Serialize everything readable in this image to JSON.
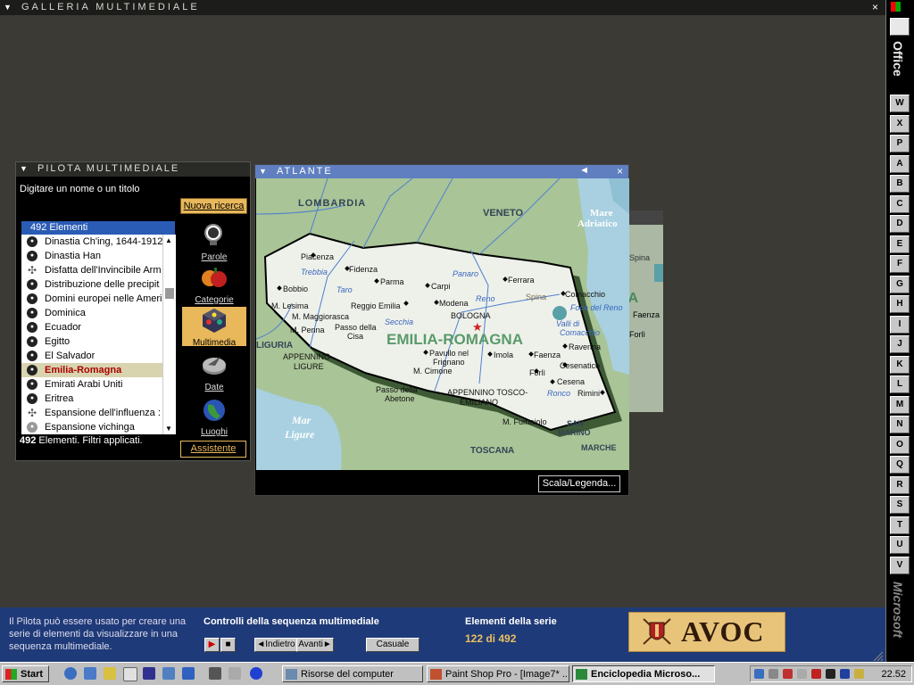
{
  "gallery": {
    "title": "GALLERIA MULTIMEDIALE",
    "menu_icon": "triangle-down-icon",
    "close": "×"
  },
  "office_bar": {
    "label_top": "Office",
    "label_bottom": "Microsoft",
    "buttons": [
      "W",
      "X",
      "P",
      "A",
      "B",
      "C",
      "D",
      "E",
      "F",
      "G",
      "H",
      "I",
      "J",
      "K",
      "L",
      "M",
      "N",
      "O",
      "Q",
      "R",
      "S",
      "T",
      "U",
      "V"
    ]
  },
  "pilota": {
    "title": "PILOTA MULTIMEDIALE",
    "prompt": "Digitare un nome o un titolo",
    "new_search": "Nuova ricerca",
    "list_header": "492 Elementi",
    "items": [
      {
        "label": "Dinastia Ch'ing, 1644-1912",
        "icon": "globe"
      },
      {
        "label": "Dinastia Han",
        "icon": "globe"
      },
      {
        "label": "Disfatta dell'Invincibile Arm",
        "icon": "compass"
      },
      {
        "label": "Distribuzione delle precipit",
        "icon": "globe"
      },
      {
        "label": "Domini europei nelle Ameri",
        "icon": "globe"
      },
      {
        "label": "Dominica",
        "icon": "globe"
      },
      {
        "label": "Ecuador",
        "icon": "globe"
      },
      {
        "label": "Egitto",
        "icon": "globe"
      },
      {
        "label": "El Salvador",
        "icon": "globe"
      },
      {
        "label": "Emilia-Romagna",
        "icon": "globe",
        "selected": true
      },
      {
        "label": "Emirati Arabi Uniti",
        "icon": "globe"
      },
      {
        "label": "Eritrea",
        "icon": "globe"
      },
      {
        "label": "Espansione dell'influenza :",
        "icon": "compass"
      },
      {
        "label": "Espansione vichinga",
        "icon": "globe-gray"
      }
    ],
    "status_count": "492",
    "status_text": " Elementi. Filtri applicati.",
    "assistant": "Assistente",
    "categories": [
      {
        "label": "Parole",
        "icon": "magnifier-icon",
        "active": false
      },
      {
        "label": "Categorie",
        "icon": "fruit-icon",
        "active": false
      },
      {
        "label": "Multimedia",
        "icon": "cube-icon",
        "active": true
      },
      {
        "label": "Date",
        "icon": "sundial-icon",
        "active": false
      },
      {
        "label": "Luoghi",
        "icon": "globe-icon",
        "active": false
      }
    ]
  },
  "atlante": {
    "title": "ATLANTE",
    "back": "◄",
    "close": "×",
    "scale_button": "Scala/Legenda...",
    "region": "EMILIA-ROMAGNA",
    "neighbors": [
      "LOMBARDIA",
      "VENETO",
      "Mare Adriatico",
      "LIGURIA",
      "TOSCANA",
      "SAN MARINO",
      "MARCHE",
      "Mar Ligure"
    ],
    "cities": [
      "Piacenza",
      "Fidenza",
      "Parma",
      "Carpi",
      "Ferrara",
      "Comacchio",
      "Bobbio",
      "Reggio Emilia",
      "Modena",
      "Spina",
      "BOLOGNA",
      "M. Lesima",
      "M. Maggiorasca",
      "Passo della Cisa",
      "M. Penna",
      "APPENNINO LIGURE",
      "Pavullo nel Frignano",
      "Imola",
      "Faenza",
      "Ravenna",
      "Cesenatico",
      "Forlì",
      "Cesena",
      "Rimini",
      "M. Cimone",
      "Passo dell'Abetone",
      "APPENNINO TOSCO-EMILIANO",
      "M. Fumaiolo"
    ],
    "rivers": [
      "Trebbia",
      "Taro",
      "Panaro",
      "Reno",
      "Secchia",
      "Valli di Comacchio",
      "Foce del Reno",
      "Ronco"
    ],
    "behind_labels": [
      "Spina",
      "IA",
      "Faenza",
      "Forlì"
    ]
  },
  "bottom": {
    "help_text": [
      "Il Pilota può essere usato per creare una",
      "serie di elementi da visualizzare in una",
      "sequenza multimediale."
    ],
    "controls_title": "Controlli della sequenza multimediale",
    "play": "▶",
    "stop": "■",
    "prev": "Indietro",
    "next": "Avanti",
    "random": "Casuale",
    "series_title": "Elementi della serie",
    "series_count": "122 di 492",
    "logo_text": "AVOC"
  },
  "taskbar": {
    "start": "Start",
    "tasks": [
      {
        "label": "Risorse del computer",
        "pressed": false
      },
      {
        "label": "Paint Shop Pro - [Image7* ...",
        "pressed": false
      },
      {
        "label": "Enciclopedia Microso...",
        "pressed": true
      }
    ],
    "clock": "22.52"
  }
}
